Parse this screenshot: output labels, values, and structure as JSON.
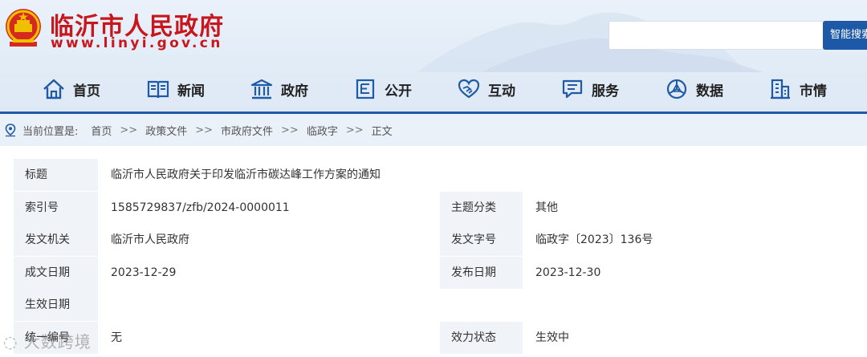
{
  "site": {
    "title": "临沂市人民政府",
    "url": "www.linyi.gov.cn"
  },
  "search": {
    "placeholder": "",
    "button_label": "智能搜索"
  },
  "nav": {
    "items": [
      {
        "label": "首页",
        "icon": "home-icon"
      },
      {
        "label": "新闻",
        "icon": "news-icon"
      },
      {
        "label": "政府",
        "icon": "government-icon"
      },
      {
        "label": "公开",
        "icon": "disclosure-icon"
      },
      {
        "label": "互动",
        "icon": "handshake-icon"
      },
      {
        "label": "服务",
        "icon": "service-icon"
      },
      {
        "label": "数据",
        "icon": "data-icon"
      },
      {
        "label": "市情",
        "icon": "city-icon"
      }
    ]
  },
  "breadcrumb": {
    "location_label": "当前位置是:",
    "items": [
      "首页",
      "政策文件",
      "市政府文件",
      "临政字",
      "正文"
    ],
    "separator": ">>"
  },
  "info": {
    "title_label": "标题",
    "title_value": "临沂市人民政府关于印发临沂市碳达峰工作方案的通知",
    "index_label": "索引号",
    "index_value": "1585729837/zfb/2024-0000011",
    "topic_label": "主题分类",
    "topic_value": "其他",
    "issuer_label": "发文机关",
    "issuer_value": "临沂市人民政府",
    "docno_label": "发文字号",
    "docno_value": "临政字〔2023〕136号",
    "written_label": "成文日期",
    "written_value": "2023-12-29",
    "published_label": "发布日期",
    "published_value": "2023-12-30",
    "effective_label": "生效日期",
    "effective_value": "",
    "unified_label": "统一编号",
    "unified_value": "无",
    "status_label": "效力状态",
    "status_value": "生效中"
  },
  "watermark": "大数跨境",
  "colors": {
    "brand_red": "#c8161d",
    "nav_blue": "#1f5aa6",
    "label_bg": "#f0f3f7"
  }
}
